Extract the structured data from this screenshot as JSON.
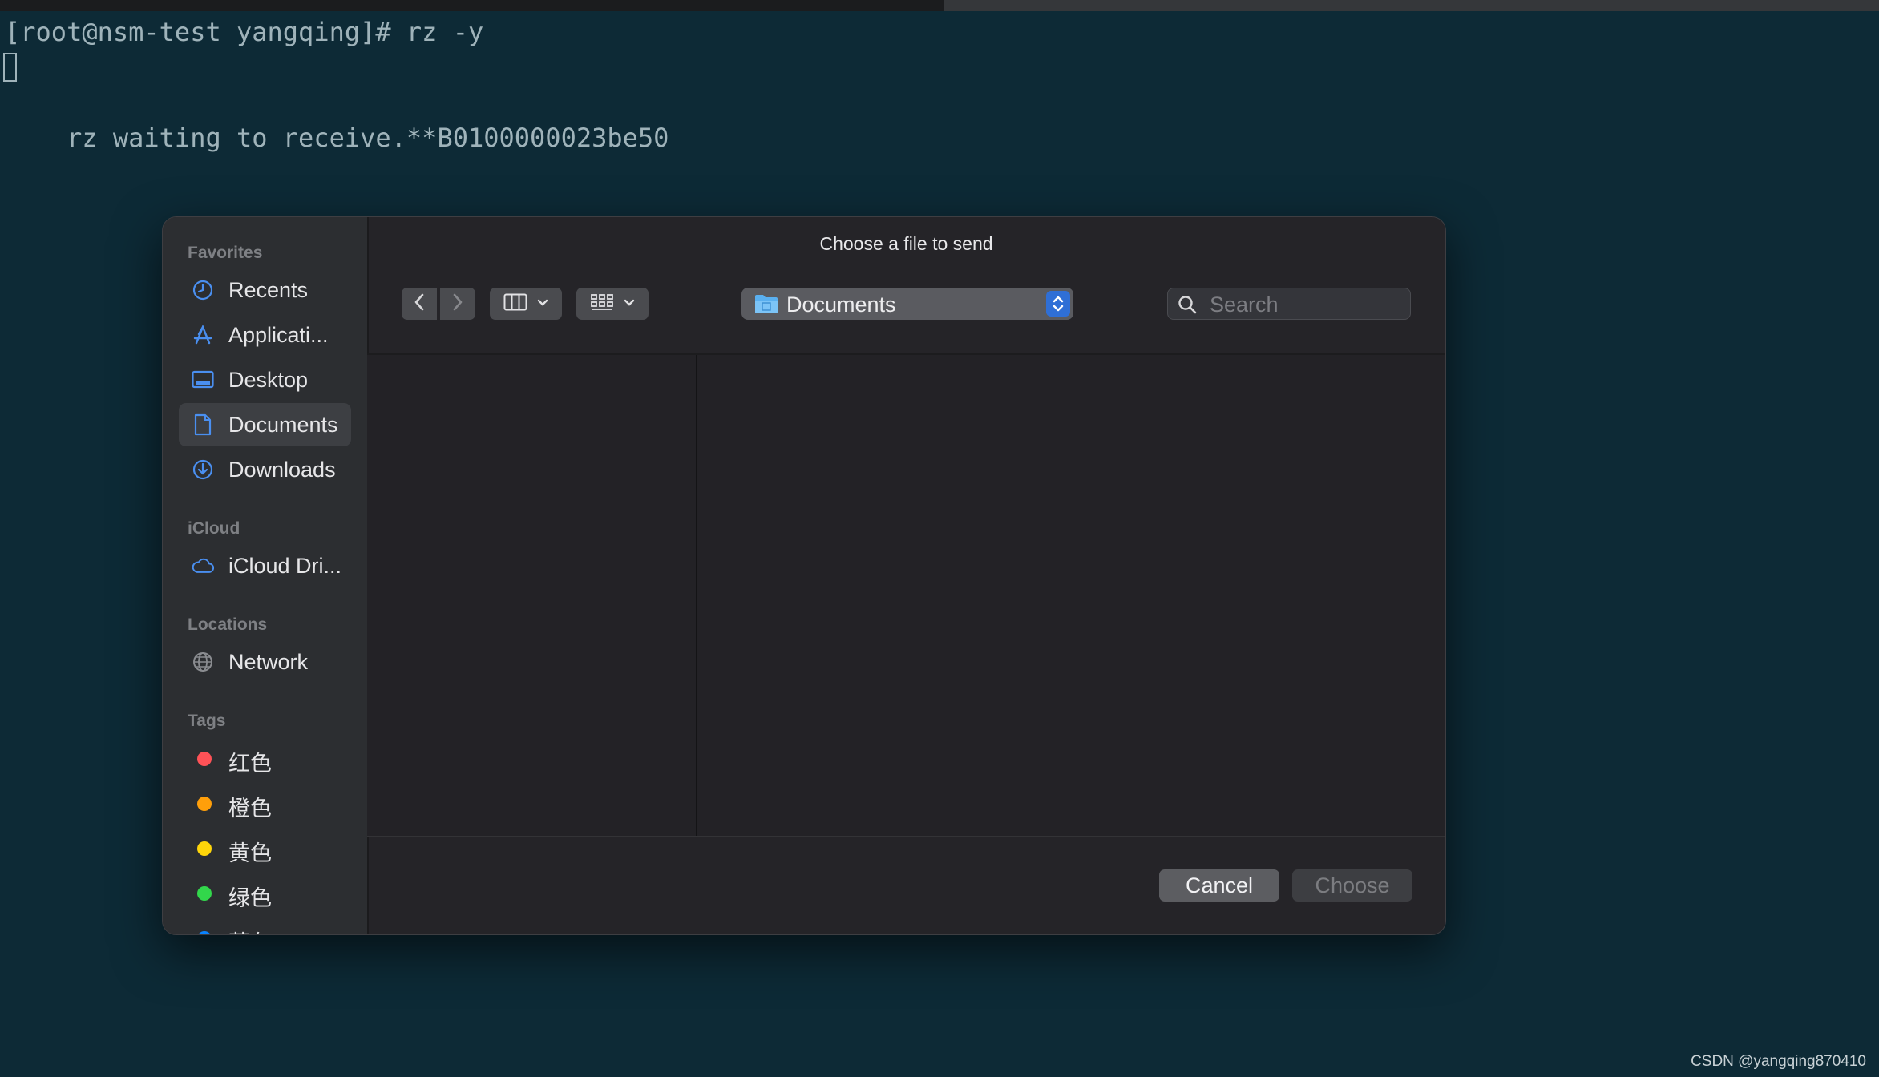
{
  "terminal": {
    "lines": [
      "[root@nsm-test yangqing]# rz -y",
      "rz waiting to receive.**B0100000023be50"
    ]
  },
  "dialog": {
    "title": "Choose a file to send",
    "sidebar": {
      "favorites_header": "Favorites",
      "favorites": [
        {
          "label": "Recents",
          "icon": "clock-icon"
        },
        {
          "label": "Applicati...",
          "icon": "applications-icon"
        },
        {
          "label": "Desktop",
          "icon": "desktop-icon"
        },
        {
          "label": "Documents",
          "icon": "document-icon",
          "selected": true
        },
        {
          "label": "Downloads",
          "icon": "download-icon"
        }
      ],
      "icloud_header": "iCloud",
      "icloud": [
        {
          "label": "iCloud Dri...",
          "icon": "cloud-icon"
        }
      ],
      "locations_header": "Locations",
      "locations": [
        {
          "label": "Network",
          "icon": "globe-icon"
        }
      ],
      "tags_header": "Tags",
      "tags": [
        {
          "label": "红色",
          "color": "#ff5257"
        },
        {
          "label": "橙色",
          "color": "#ff9f0a"
        },
        {
          "label": "黄色",
          "color": "#ffd60a"
        },
        {
          "label": "绿色",
          "color": "#32d74b"
        },
        {
          "label": "蓝色",
          "color": "#0a84ff"
        }
      ]
    },
    "toolbar": {
      "location": "Documents",
      "search_placeholder": "Search"
    },
    "buttons": {
      "cancel": "Cancel",
      "choose": "Choose"
    }
  },
  "watermark": "CSDN @yangqing870410",
  "colors": {
    "terminal_bg": "#0d2a36",
    "accent": "#2f6fd6",
    "sidebar_icon": "#4a8ff0"
  }
}
